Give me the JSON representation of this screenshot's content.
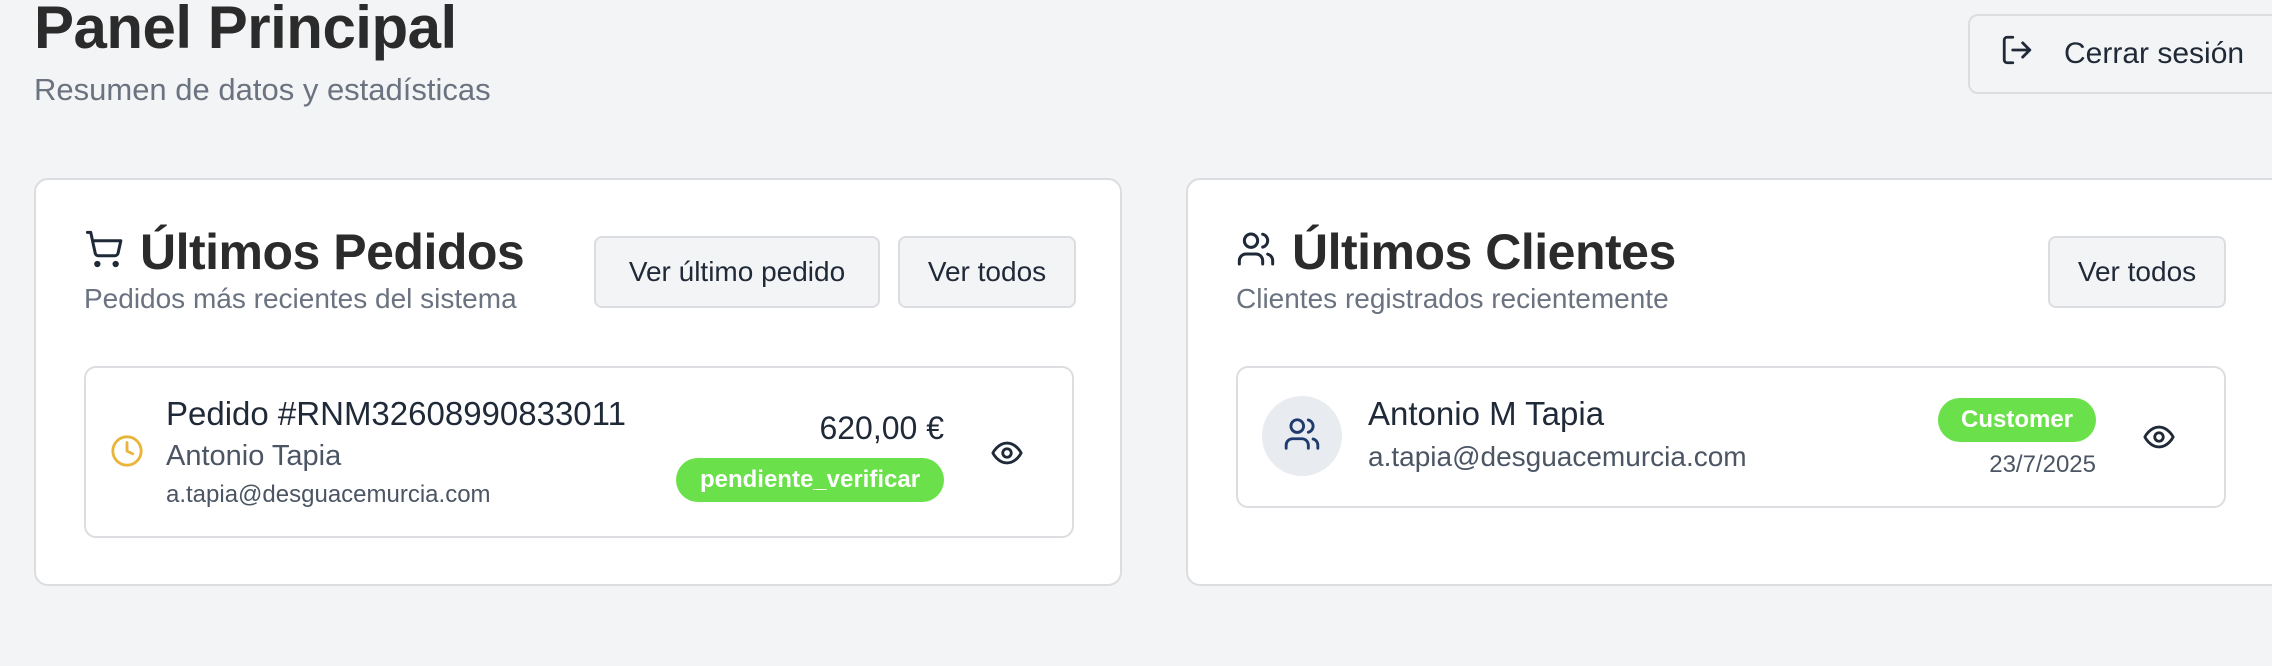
{
  "header": {
    "title": "Panel Principal",
    "subtitle": "Resumen de datos y estadísticas",
    "logout_label": "Cerrar sesión",
    "logout_icon": "log-out-icon"
  },
  "orders_card": {
    "icon": "shopping-cart-icon",
    "title": "Últimos Pedidos",
    "description": "Pedidos más recientes del sistema",
    "view_last_label": "Ver último pedido",
    "view_all_label": "Ver todos",
    "items": [
      {
        "status_icon": "clock-icon",
        "order_number": "Pedido #RNM32608990833011",
        "customer_name": "Antonio Tapia",
        "customer_email": "a.tapia@desguacemurcia.com",
        "amount": "620,00 €",
        "status": "pendiente_verificar",
        "view_icon": "eye-icon"
      }
    ]
  },
  "clients_card": {
    "icon": "users-icon",
    "title": "Últimos Clientes",
    "description": "Clientes registrados recientemente",
    "view_all_label": "Ver todos",
    "items": [
      {
        "avatar_icon": "users-icon",
        "name": "Antonio M Tapia",
        "email": "a.tapia@desguacemurcia.com",
        "role": "Customer",
        "date": "23/7/2025",
        "view_icon": "eye-icon"
      }
    ]
  },
  "colors": {
    "badge_green": "#6ae14a",
    "clock_yellow": "#e8b53a",
    "avatar_icon_blue": "#1e3a6e",
    "background": "#f3f4f6"
  }
}
